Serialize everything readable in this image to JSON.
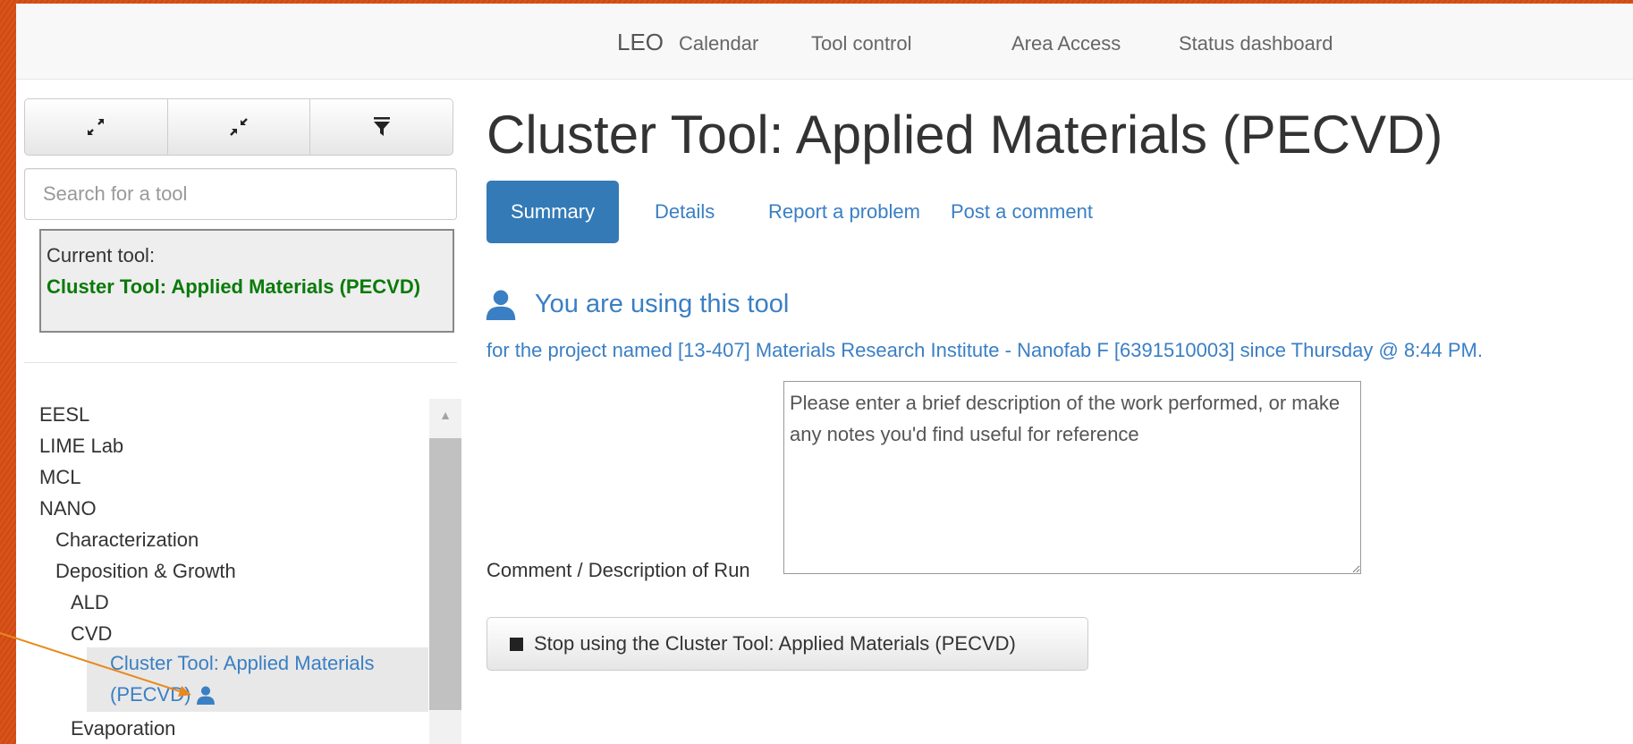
{
  "navbar": {
    "brand": "LEO",
    "items": [
      "Calendar",
      "Tool control",
      "Area Access",
      "Status dashboard"
    ]
  },
  "sidebar": {
    "buttons": [
      "expand-icon",
      "collapse-icon",
      "filter-icon"
    ],
    "search_placeholder": "Search for a tool",
    "current_tool_label": "Current tool:",
    "current_tool_name": "Cluster Tool: Applied Materials (PECVD)",
    "tree": [
      {
        "label": "EESL",
        "level": 0
      },
      {
        "label": "LIME Lab",
        "level": 0
      },
      {
        "label": "MCL",
        "level": 0
      },
      {
        "label": "NANO",
        "level": 0
      },
      {
        "label": "Characterization",
        "level": 1
      },
      {
        "label": "Deposition & Growth",
        "level": 1
      },
      {
        "label": "ALD",
        "level": 2
      },
      {
        "label": "CVD",
        "level": 2
      }
    ],
    "active_tool": {
      "line1": "Cluster Tool: Applied Materials",
      "line2": "(PECVD)"
    },
    "tree_after": [
      {
        "label": "Evaporation",
        "level": 2
      }
    ]
  },
  "main": {
    "title": "Cluster Tool: Applied Materials (PECVD)",
    "tabs": [
      {
        "label": "Summary",
        "active": true
      },
      {
        "label": "Details",
        "active": false
      },
      {
        "label": "Report a problem",
        "active": false
      },
      {
        "label": "Post a comment",
        "active": false
      }
    ],
    "using_heading": "You are using this tool",
    "project_line": "for the project named [13-407] Materials Research Institute - Nanofab F [6391510003] since Thursday @ 8:44 PM.",
    "comment_label": "Comment / Description of Run",
    "comment_placeholder": "Please enter a brief description of the work performed, or make any notes you'd find useful for reference",
    "stop_button_label": "Stop using the Cluster Tool: Applied Materials (PECVD)"
  },
  "colors": {
    "accent": "#337ab7",
    "link": "#3a7fc4",
    "current_tool_green": "#0a7a0a",
    "annotation_arrow": "#e8891e",
    "background_stripes": "#d8531a"
  }
}
